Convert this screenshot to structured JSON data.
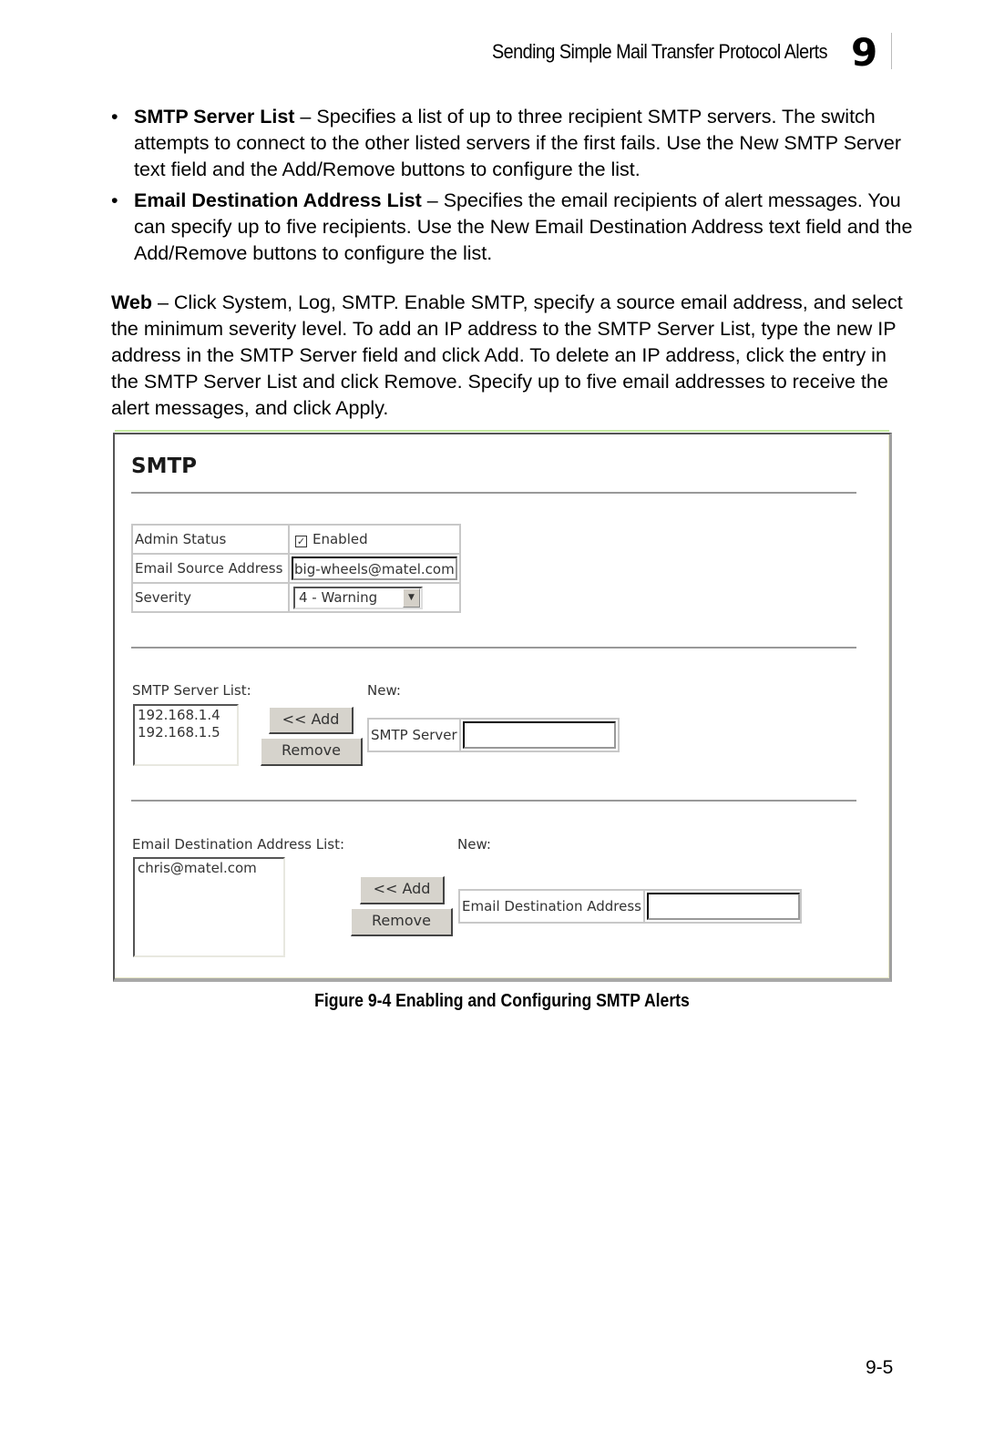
{
  "header": {
    "running_title": "Sending Simple Mail Transfer Protocol Alerts",
    "chapter_number": "9"
  },
  "bullets": [
    {
      "term": "SMTP Server List",
      "text": " – Specifies a list of up to three recipient SMTP servers. The switch attempts to connect to the other listed servers if the first fails. Use the New SMTP Server text field and the Add/Remove buttons to configure the list."
    },
    {
      "term": "Email Destination Address List",
      "text": " – Specifies the email recipients of alert messages. You can specify up to five recipients. Use the New Email Destination Address text field and the Add/Remove buttons to configure the list."
    }
  ],
  "web_paragraph": {
    "term": "Web",
    "text": " – Click System, Log, SMTP. Enable SMTP, specify a source email address, and select the minimum severity level. To add an IP address to the SMTP Server List, type the new IP address in the SMTP Server field and click Add. To delete an IP address, click the entry in the SMTP Server List and click Remove. Specify up to five email addresses to receive the alert messages, and click Apply."
  },
  "figure": {
    "title": "SMTP",
    "settings": {
      "admin_status_label": "Admin Status",
      "admin_status_checkbox": "Enabled",
      "admin_status_checked": true,
      "check_glyph": "✓",
      "source_address_label": "Email Source Address",
      "source_address_value": "big-wheels@matel.com",
      "severity_label": "Severity",
      "severity_value": "4 - Warning",
      "dropdown_glyph": "▼"
    },
    "smtp_server": {
      "list_label": "SMTP Server List:",
      "items": [
        "192.168.1.4",
        "192.168.1.5"
      ],
      "add_button": "<< Add",
      "remove_button": "Remove",
      "new_label": "New:",
      "field_label": "SMTP Server",
      "field_value": ""
    },
    "email_destination": {
      "list_label": "Email Destination Address List:",
      "items": [
        "chris@matel.com"
      ],
      "add_button": "<< Add",
      "remove_button": "Remove",
      "new_label": "New:",
      "field_label": "Email Destination Address",
      "field_value": ""
    }
  },
  "caption": "Figure 9-4  Enabling and Configuring SMTP Alerts",
  "page_number": "9-5"
}
